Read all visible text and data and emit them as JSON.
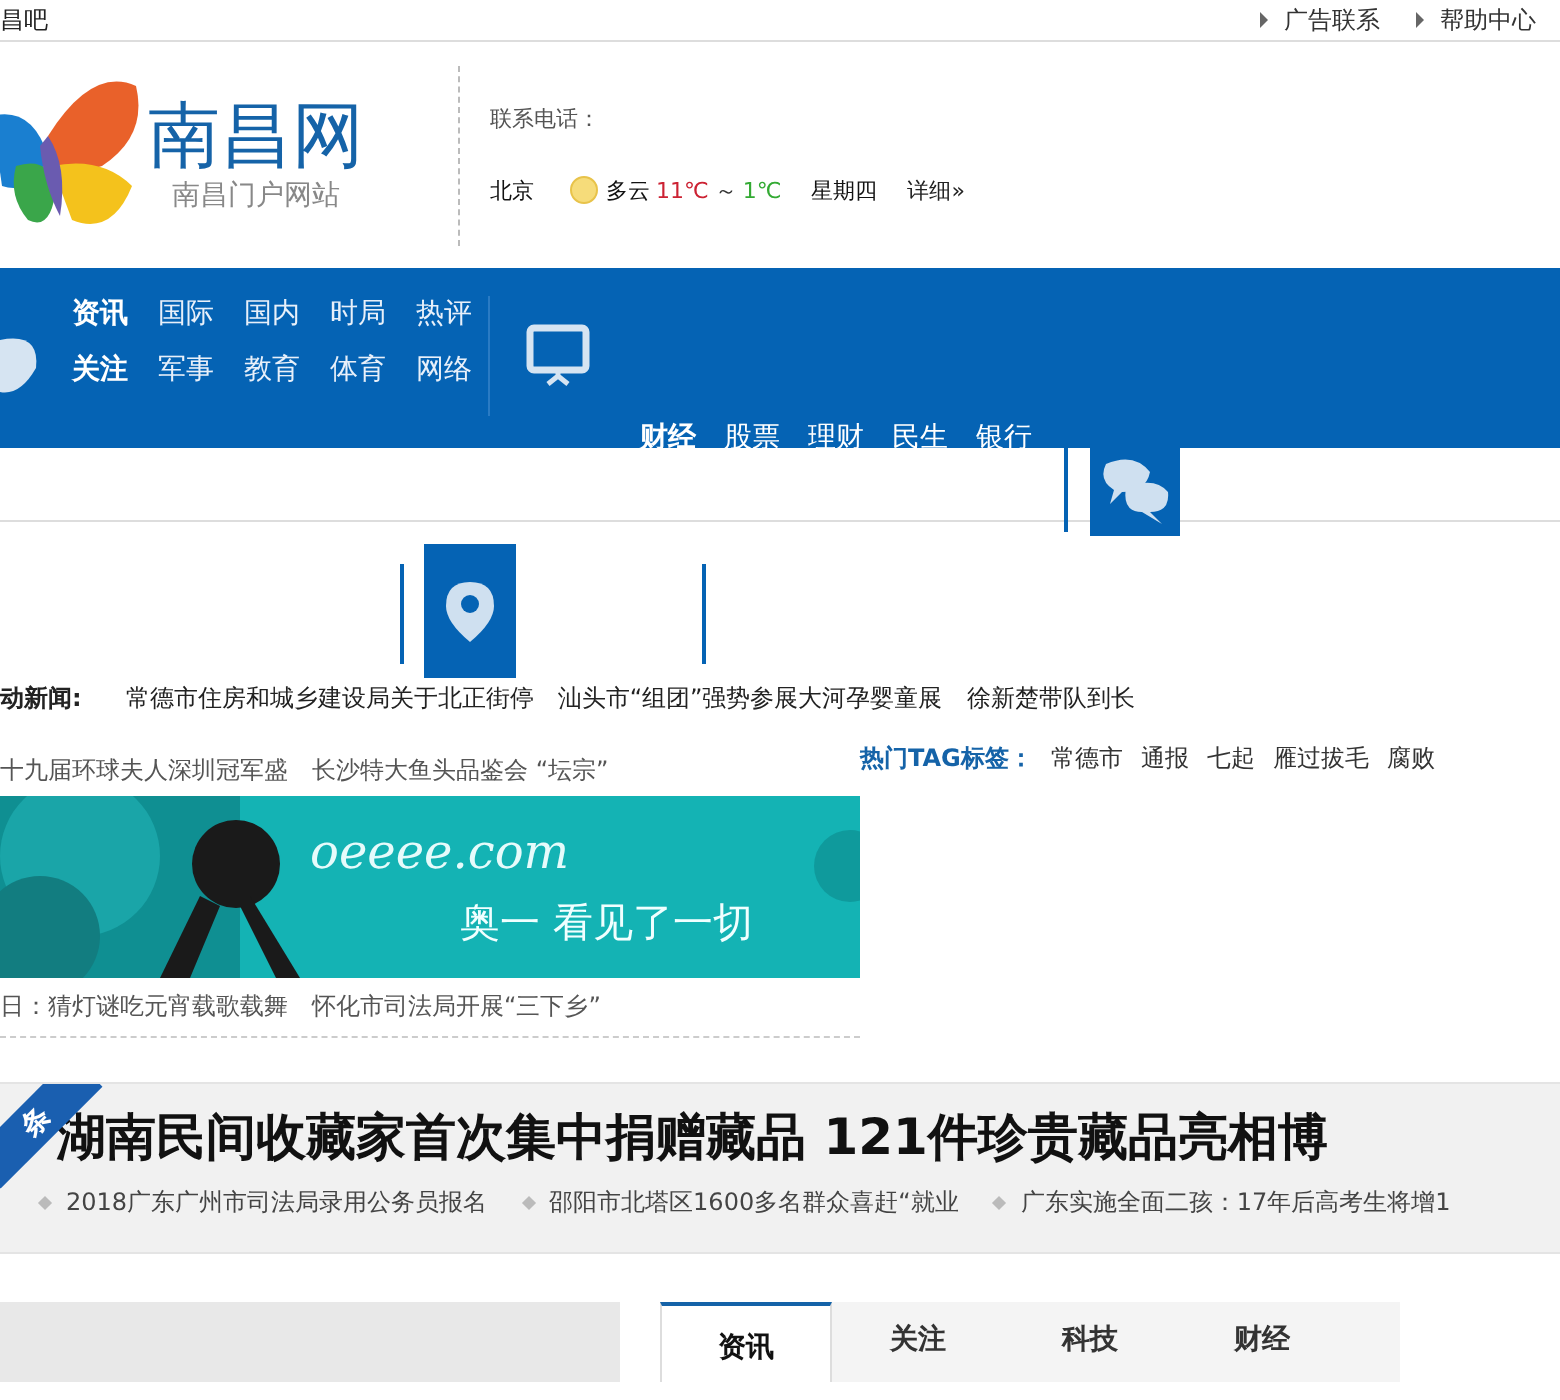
{
  "top_bar": {
    "site_link": "昌吧",
    "links": [
      "广告联系",
      "帮助中心"
    ]
  },
  "header": {
    "logo_title": "南昌网",
    "logo_subtitle": "南昌门户网站",
    "contact_label": "联系电话：",
    "weather": {
      "city": "北京",
      "condition": "多云",
      "high": "11℃",
      "separator": "～",
      "low": "1℃",
      "weekday": "星期四",
      "details": "详细»"
    }
  },
  "nav": {
    "rows": [
      [
        {
          "label": "资讯",
          "featured": true
        },
        {
          "label": "国际",
          "featured": false
        },
        {
          "label": "国内",
          "featured": false
        },
        {
          "label": "时局",
          "featured": false
        },
        {
          "label": "热评",
          "featured": false
        }
      ],
      [
        {
          "label": "关注",
          "featured": true
        },
        {
          "label": "军事",
          "featured": false
        },
        {
          "label": "教育",
          "featured": false
        },
        {
          "label": "体育",
          "featured": false
        },
        {
          "label": "网络",
          "featured": false
        }
      ]
    ],
    "sub_links": [
      {
        "label": "财经",
        "featured": true
      },
      {
        "label": "股票",
        "featured": false
      },
      {
        "label": "理财",
        "featured": false
      },
      {
        "label": "民生",
        "featured": false
      },
      {
        "label": "银行",
        "featured": false
      }
    ]
  },
  "news_ticker": {
    "label": "动新闻:",
    "items": [
      "常德市住房和城乡建设局关于北正街停",
      "汕头市“组团”强势参展大河孕婴童展",
      "徐新楚带队到长"
    ]
  },
  "list_top": [
    "十九届环球夫人深圳冠军盛",
    "长沙特大鱼头品鉴会 “坛宗”"
  ],
  "hot_tags": {
    "label": "热门TAG标签：",
    "tags": [
      "常德市",
      "通报",
      "七起",
      "雁过拔毛",
      "腐败"
    ]
  },
  "banner": {
    "kind": "picture",
    "brand": "oeeee.com",
    "slogan": "奥一 看见了一切"
  },
  "list_bottom": [
    "日：猜灯谜吃元宵载歌载舞",
    "怀化市司法局开展“三下乡”"
  ],
  "headline": {
    "badge": "条",
    "title": "湖南民间收藏家首次集中捐赠藏品 121件珍贵藏品亮相博",
    "items": [
      "2018广东广州市司法局录用公务员报名",
      "邵阳市北塔区1600多名群众喜赶“就业",
      "广东实施全面二孩：17年后高考生将增1"
    ]
  },
  "tabs": [
    {
      "label": "资讯",
      "selected": true
    },
    {
      "label": "关注",
      "selected": false
    },
    {
      "label": "科技",
      "selected": false
    },
    {
      "label": "财经",
      "selected": false
    }
  ]
}
